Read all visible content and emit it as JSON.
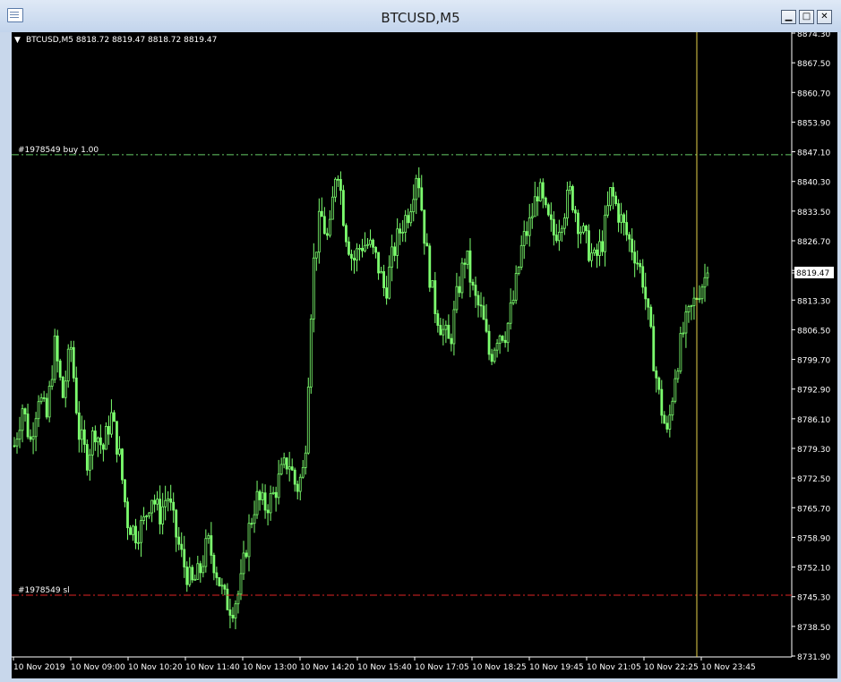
{
  "window": {
    "title": "BTCUSD,M5",
    "buttons": {
      "minimize": "▁",
      "maximize": "□",
      "close": "✕"
    }
  },
  "chart_header": {
    "arrow": "▼",
    "text": "BTCUSD,M5  8818.72 8819.47 8818.72 8819.47"
  },
  "colors": {
    "background": "#000000",
    "candle": "#7cff6e",
    "buy_line": "#66cc66",
    "sl_line": "#e02424",
    "vline": "#e6d24a",
    "axis": "#ffffff"
  },
  "order_lines": [
    {
      "label": "#1978549 buy 1.00",
      "price": 8846.5,
      "type": "buy"
    },
    {
      "label": "#1978549 sl",
      "price": 8745.8,
      "type": "sl"
    }
  ],
  "current_price_label": "8819.47",
  "chart_data": {
    "type": "candlestick",
    "symbol": "BTCUSD",
    "timeframe": "M5",
    "ylim": [
      8731.9,
      8874.3
    ],
    "y_ticks": [
      "8874.30",
      "8867.50",
      "8860.70",
      "8853.90",
      "8847.10",
      "8840.30",
      "8833.50",
      "8826.70",
      "8819.90",
      "8813.30",
      "8806.50",
      "8799.70",
      "8792.90",
      "8786.10",
      "8779.30",
      "8772.50",
      "8765.70",
      "8758.90",
      "8752.10",
      "8745.30",
      "8738.50",
      "8731.90"
    ],
    "x_ticks": [
      "10 Nov 2019",
      "10 Nov 09:00",
      "10 Nov 10:20",
      "10 Nov 11:40",
      "10 Nov 13:00",
      "10 Nov 14:20",
      "10 Nov 15:40",
      "10 Nov 17:05",
      "10 Nov 18:25",
      "10 Nov 19:45",
      "10 Nov 21:05",
      "10 Nov 22:25",
      "10 Nov 23:45"
    ],
    "close_path": [
      8780,
      8789,
      8781,
      8792,
      8786,
      8803,
      8791,
      8803,
      8783,
      8777,
      8784,
      8779,
      8787,
      8778,
      8763,
      8760,
      8762,
      8769,
      8764,
      8769,
      8760,
      8753,
      8748,
      8751,
      8758,
      8752,
      8745,
      8743,
      8747,
      8760,
      8768,
      8766,
      8768,
      8773,
      8777,
      8770,
      8775,
      8820,
      8833,
      8826,
      8846,
      8830,
      8822,
      8826,
      8826,
      8822,
      8815,
      8824,
      8830,
      8834,
      8844,
      8826,
      8813,
      8807,
      8803,
      8815,
      8824,
      8814,
      8810,
      8800,
      8806,
      8806,
      8814,
      8826,
      8831,
      8839,
      8832,
      8828,
      8833,
      8838,
      8831,
      8826,
      8822,
      8827,
      8838,
      8833,
      8828,
      8824,
      8818,
      8804,
      8791,
      8782,
      8797,
      8806,
      8811,
      8816,
      8819.47
    ]
  }
}
